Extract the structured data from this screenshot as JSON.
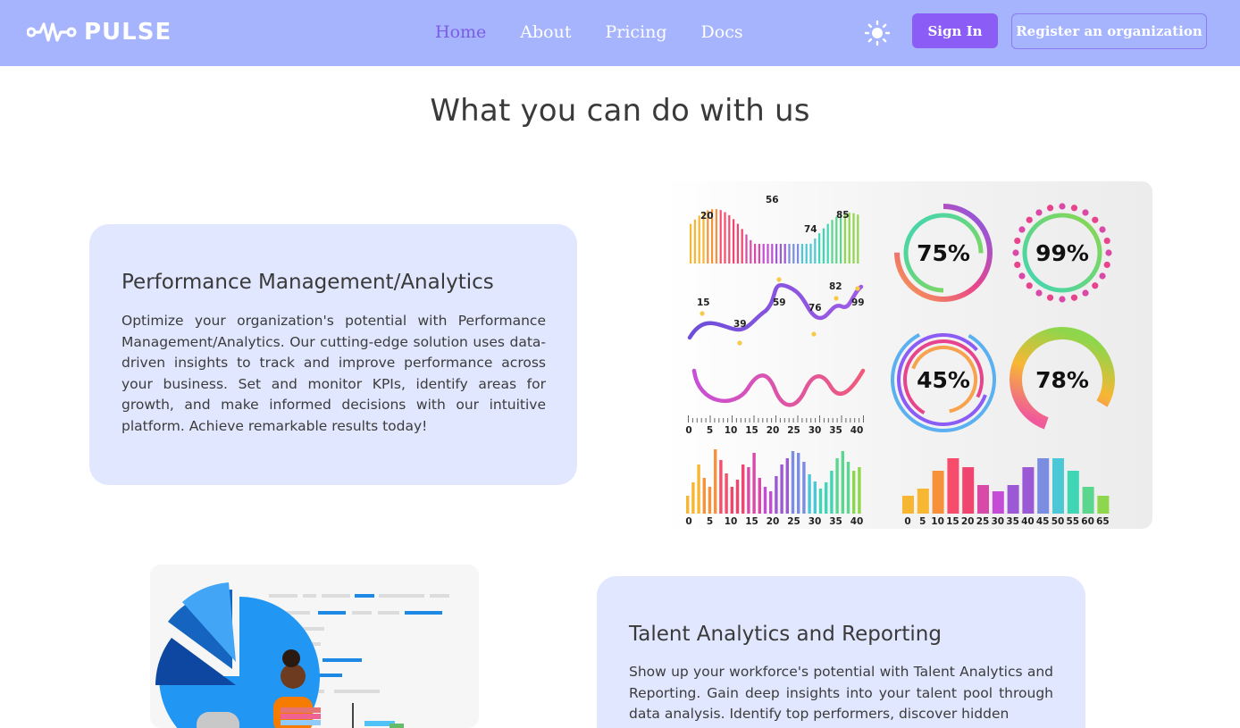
{
  "header": {
    "brand": "PULSE",
    "nav": [
      {
        "label": "Home",
        "active": true
      },
      {
        "label": "About",
        "active": false
      },
      {
        "label": "Pricing",
        "active": false
      },
      {
        "label": "Docs",
        "active": false
      }
    ],
    "theme_icon": "sun-icon",
    "sign_in_label": "Sign In",
    "register_label": "Register an organization",
    "colors": {
      "bar": "#a5b4fc",
      "accent": "#8b5cf6",
      "active_link": "#7c5ce6"
    }
  },
  "section": {
    "title": "What you can do with us"
  },
  "features": [
    {
      "title": "Performance Management/Analytics",
      "body": "Optimize your organization's potential with Performance Management/Analytics. Our cutting-edge solution uses data-driven insights to track and improve performance across your business. Set and monitor KPIs, identify areas for growth, and make informed decisions with our intuitive platform. Achieve remarkable results today!"
    },
    {
      "title": "Talent Analytics and Reporting",
      "body": "Show up your workforce's potential with Talent Analytics and Reporting. Gain deep insights into your talent pool through data analysis. Identify top performers, discover hidden"
    }
  ],
  "illustration": {
    "peak_labels": [
      "20",
      "56",
      "74",
      "85"
    ],
    "wave_labels": [
      "15",
      "39",
      "59",
      "76",
      "82",
      "99"
    ],
    "axis_ticks_a": [
      "0",
      "5",
      "10",
      "15",
      "20",
      "25",
      "30",
      "35",
      "40"
    ],
    "axis_ticks_b": [
      "0",
      "5",
      "10",
      "15",
      "20",
      "25",
      "30",
      "35",
      "40",
      "45",
      "50",
      "55",
      "60",
      "65"
    ],
    "percentages": [
      "75%",
      "99%",
      "45%",
      "78%"
    ]
  }
}
